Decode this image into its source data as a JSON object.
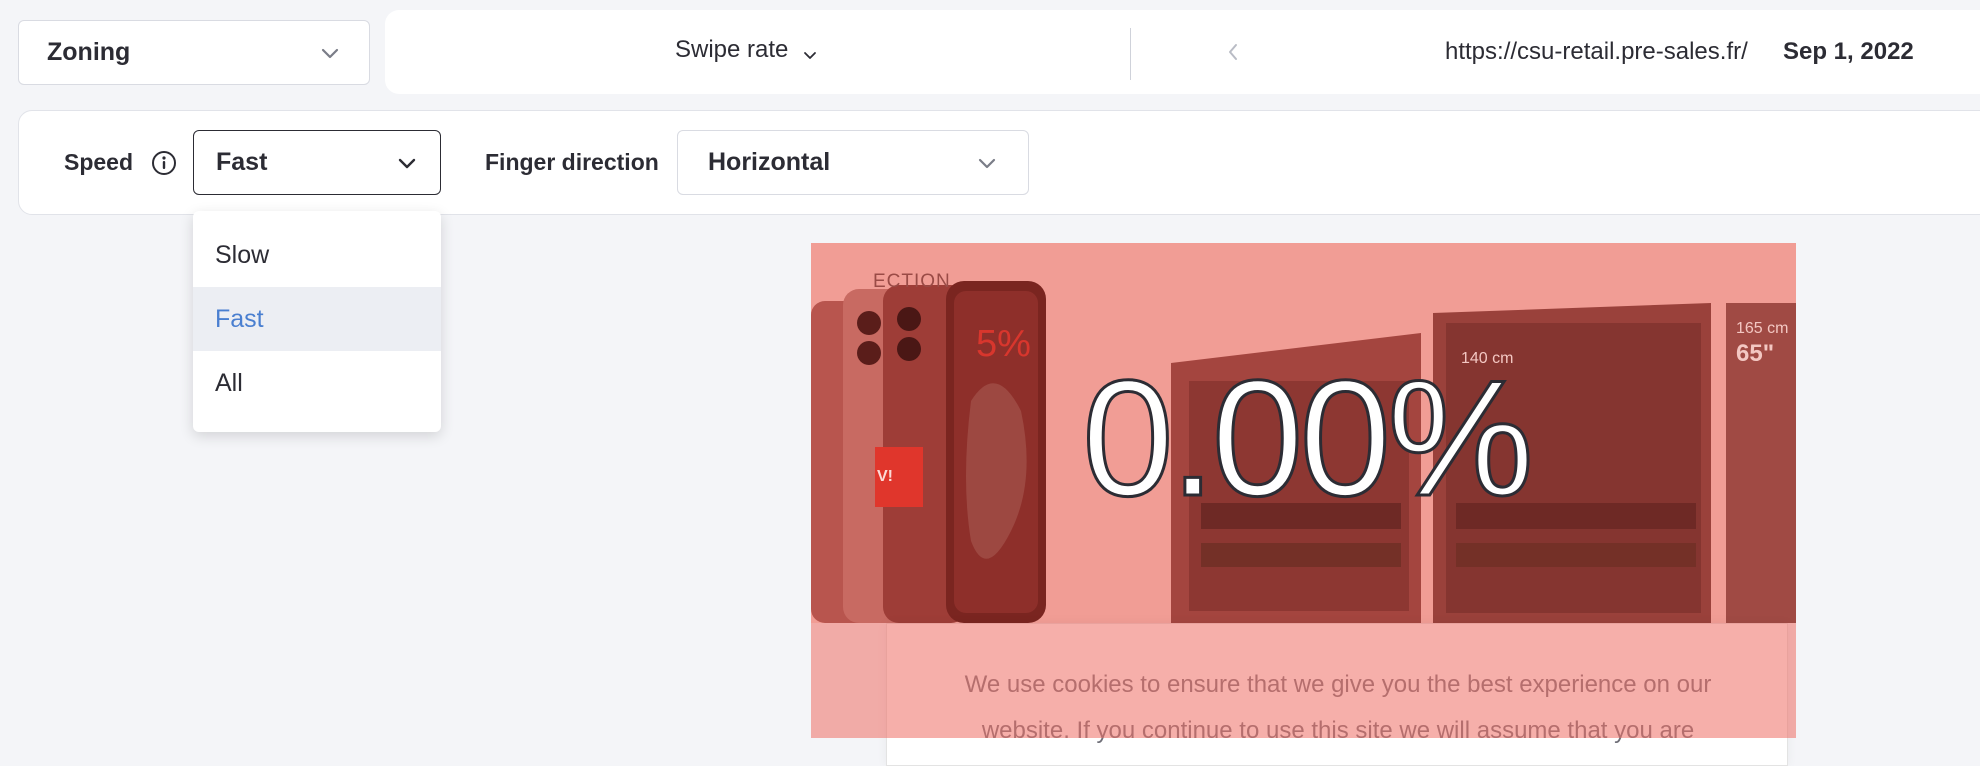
{
  "zoning": {
    "label": "Zoning"
  },
  "top_bar": {
    "metric_label": "Swipe rate",
    "url": "https://csu-retail.pre-sales.fr/",
    "date": "Sep 1, 2022"
  },
  "filters": {
    "speed_label": "Speed",
    "speed_value": "Fast",
    "speed_options": [
      "Slow",
      "Fast",
      "All"
    ],
    "finger_direction_label": "Finger direction",
    "finger_direction_value": "Horizontal"
  },
  "preview": {
    "metric_value": "0.00%",
    "banner_caption": "ECTION",
    "banner_percent": "5%",
    "banner_tag": "V!",
    "tv_size_a": "140 cm",
    "tv_size_b": "165 cm",
    "tv_inches": "65\"",
    "cookie_text": "We use cookies to ensure that we give you the best experience on our website. If you continue to use this site we will assume that you are"
  },
  "colors": {
    "overlay": "#f19d95",
    "accent_blue": "#4a7fd0",
    "text_dark": "#2c2c34",
    "red": "#e0362c"
  }
}
